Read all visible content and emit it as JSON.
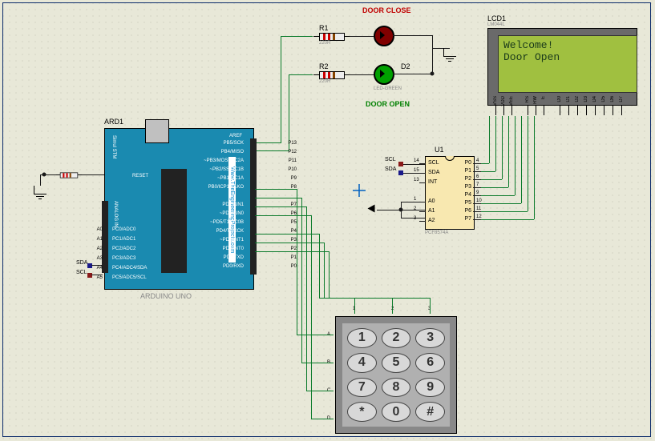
{
  "labels": {
    "door_close": "DOOR CLOSE",
    "door_open": "DOOR OPEN",
    "ard_ref": "ARD1",
    "ard_name": "ARDUINO UNO",
    "r1_ref": "R1",
    "r1_val": "220R",
    "r2_ref": "R2",
    "r2_val": "220R",
    "d2_ref": "D2",
    "d2_val": "LED-GREEN",
    "lcd_ref": "LCD1",
    "lcd_val": "LM044L",
    "u1_ref": "U1",
    "u1_val": "PCF8574A",
    "scl": "SCL",
    "sda": "SDA",
    "a5": "A5",
    "a4": "A4",
    "reset": "RESET",
    "aref": "AREF",
    "analog": "ANALOG IN",
    "brand": "Www.TheEngineeringProjects.com",
    "sim_model": "Simul STM"
  },
  "arduino_right_pins": [
    "P13",
    "P12",
    "P11",
    "P10",
    "P9",
    "P8",
    "",
    "P7",
    "P6",
    "P5",
    "P4",
    "P3",
    "P2",
    "P1",
    "P0"
  ],
  "arduino_right_inner": [
    "PB5/SCK",
    "PB4/MISO",
    "~PB3/MOSI/OC2A",
    "~PB2/SS/OC1B",
    "~PB1/OC1A",
    "PB0/ICP1/CLKO",
    "",
    "PD7/AIN1",
    "~PD6/AIN0",
    "~PD5/T1/OC0B",
    "PD4/T0/XCK",
    "~PD3/INT1",
    "PD2/INT0",
    "PD1/TXD",
    "PD0/RXD"
  ],
  "arduino_left_pins": [
    "A0",
    "A1",
    "A2",
    "A3",
    "A4",
    "A5"
  ],
  "arduino_left_inner": [
    "PC0/ADC0",
    "PC1/ADC1",
    "PC2/ADC2",
    "PC3/ADC3",
    "PC4/ADC4/SDA",
    "PC5/ADC5/SCL"
  ],
  "ic_left": [
    {
      "n": "14",
      "t": "SCL"
    },
    {
      "n": "15",
      "t": "SDA"
    },
    {
      "n": "13",
      "t": "INT"
    },
    {
      "n": "",
      "t": ""
    },
    {
      "n": "1",
      "t": "A0"
    },
    {
      "n": "2",
      "t": "A1"
    },
    {
      "n": "3",
      "t": "A2"
    }
  ],
  "ic_right": [
    {
      "n": "4",
      "t": "P0"
    },
    {
      "n": "5",
      "t": "P1"
    },
    {
      "n": "6",
      "t": "P2"
    },
    {
      "n": "7",
      "t": "P3"
    },
    {
      "n": "9",
      "t": "P4"
    },
    {
      "n": "10",
      "t": "P5"
    },
    {
      "n": "11",
      "t": "P6"
    },
    {
      "n": "12",
      "t": "P7"
    }
  ],
  "lcd_pins_l": [
    "VSS",
    "VDD",
    "VEE"
  ],
  "lcd_pins_m": [
    "RS",
    "RW",
    "E"
  ],
  "lcd_pins_r": [
    "D0",
    "D1",
    "D2",
    "D3",
    "D4",
    "D5",
    "D6",
    "D7"
  ],
  "lcd_text": {
    "line1": " Welcome!",
    "line2": " Door Open"
  },
  "keypad_cols": [
    "1",
    "2",
    "3"
  ],
  "keypad_rows_lbl": [
    "A",
    "B",
    "C",
    "D"
  ],
  "keys": [
    "1",
    "2",
    "3",
    "4",
    "5",
    "6",
    "7",
    "8",
    "9",
    "*",
    "0",
    "#"
  ],
  "net": {
    "scl": "SCL",
    "sda": "SDA"
  }
}
